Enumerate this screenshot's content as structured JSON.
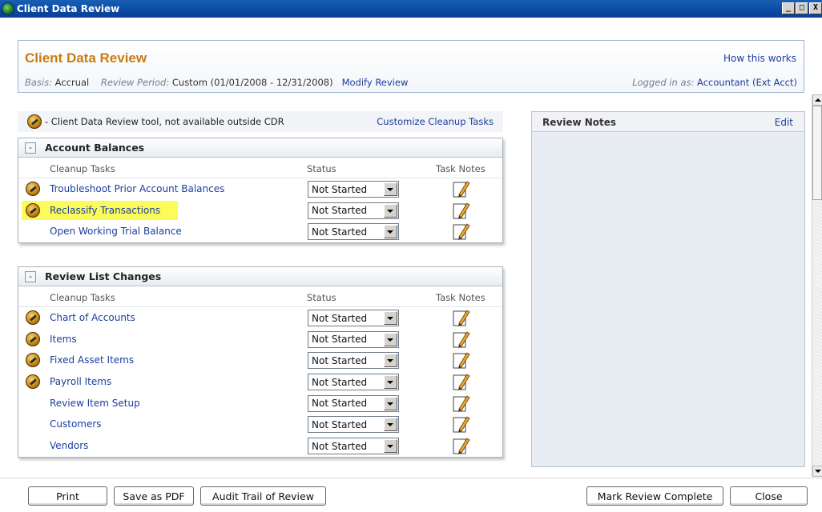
{
  "window": {
    "title": "Client Data Review",
    "controls": [
      "_",
      "□",
      "X"
    ]
  },
  "header": {
    "title": "Client Data Review",
    "how_link": "How this works",
    "basis_label": "Basis:",
    "basis_value": "Accrual",
    "period_label": "Review Period:",
    "period_value": "Custom (01/01/2008 - 12/31/2008)",
    "modify_link": "Modify Review",
    "logged_label": "Logged in as:",
    "logged_value": "Accountant (Ext Acct)"
  },
  "legend": {
    "icon": "cdr-tool-icon",
    "text": "- Client Data Review tool, not available outside CDR",
    "customize_link": "Customize Cleanup Tasks"
  },
  "columns": {
    "tasks": "Cleanup Tasks",
    "status": "Status",
    "notes": "Task Notes"
  },
  "sections": [
    {
      "title": "Account Balances",
      "collapse": "-",
      "tasks": [
        {
          "label": "Troubleshoot Prior Account Balances",
          "tool": true,
          "status": "Not Started",
          "highlight": false
        },
        {
          "label": "Reclassify Transactions",
          "tool": true,
          "status": "Not Started",
          "highlight": true
        },
        {
          "label": "Open Working Trial Balance",
          "tool": false,
          "status": "Not Started",
          "highlight": false
        }
      ]
    },
    {
      "title": "Review List Changes",
      "collapse": "-",
      "tasks": [
        {
          "label": "Chart of Accounts",
          "tool": true,
          "status": "Not Started",
          "highlight": false
        },
        {
          "label": "Items",
          "tool": true,
          "status": "Not Started",
          "highlight": false
        },
        {
          "label": "Fixed Asset Items",
          "tool": true,
          "status": "Not Started",
          "highlight": false
        },
        {
          "label": "Payroll Items",
          "tool": true,
          "status": "Not Started",
          "highlight": false
        },
        {
          "label": "Review Item Setup",
          "tool": false,
          "status": "Not Started",
          "highlight": false
        },
        {
          "label": "Customers",
          "tool": false,
          "status": "Not Started",
          "highlight": false
        },
        {
          "label": "Vendors",
          "tool": false,
          "status": "Not Started",
          "highlight": false
        }
      ]
    }
  ],
  "review_notes": {
    "title": "Review Notes",
    "edit_link": "Edit"
  },
  "footer": {
    "print": "Print",
    "save_pdf": "Save as PDF",
    "audit_trail": "Audit Trail of Review",
    "mark_complete": "Mark Review Complete",
    "close": "Close"
  },
  "colors": {
    "title_orange": "#c87d0e",
    "link_blue": "#1c3e9e",
    "highlight_yellow": "#fbfb5a",
    "titlebar_blue": "#0a4aa6"
  }
}
